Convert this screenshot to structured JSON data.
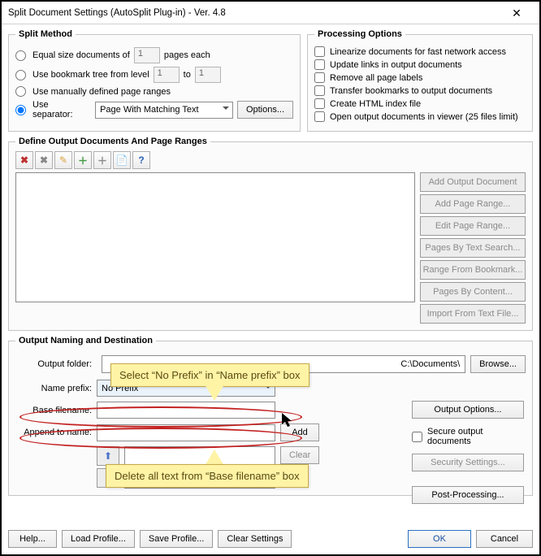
{
  "title": "Split Document Settings (AutoSplit Plug-in) - Ver. 4.8",
  "split_method": {
    "legend": "Split Method",
    "opt_equal": "Equal size documents of",
    "opt_equal_pages": "1",
    "opt_equal_suffix": "pages each",
    "opt_bookmark": "Use bookmark tree from level",
    "opt_bookmark_level": "1",
    "opt_bookmark_to": "to",
    "opt_bookmark_level2": "1",
    "opt_manual": "Use manually defined page ranges",
    "opt_separator": "Use separator:",
    "separator_value": "Page With Matching Text",
    "options_btn": "Options..."
  },
  "processing": {
    "legend": "Processing Options",
    "c1": "Linearize documents for fast network access",
    "c2": "Update links in output documents",
    "c3": "Remove all page labels",
    "c4": "Transfer bookmarks to output documents",
    "c5": "Create HTML index file",
    "c6": "Open output documents in viewer (25 files limit)"
  },
  "define": {
    "legend": "Define Output Documents And Page Ranges",
    "side_add_doc": "Add Output Document",
    "side_add_range": "Add Page Range...",
    "side_edit_range": "Edit Page Range...",
    "side_text_search": "Pages By Text Search...",
    "side_bookmark": "Range From Bookmark...",
    "side_content": "Pages By Content...",
    "side_import": "Import From Text File..."
  },
  "output": {
    "legend": "Output Naming and Destination",
    "folder_label": "Output folder:",
    "folder_value": "C:\\Documents\\",
    "browse": "Browse...",
    "prefix_label": "Name prefix:",
    "prefix_value": "No Prefix",
    "base_label": "Base filename:",
    "base_value": "",
    "append_label": "Append to name:",
    "add": "Add",
    "clear": "Clear",
    "output_options": "Output Options...",
    "secure": "Secure output documents",
    "security_settings": "Security Settings...",
    "post_processing": "Post-Processing..."
  },
  "footer": {
    "help": "Help...",
    "load": "Load Profile...",
    "save": "Save Profile...",
    "clear": "Clear Settings",
    "ok": "OK",
    "cancel": "Cancel"
  },
  "annotations": {
    "callout1": "Select “No Prefix” in “Name prefix” box",
    "callout2": "Delete all text from “Base filename” box"
  }
}
